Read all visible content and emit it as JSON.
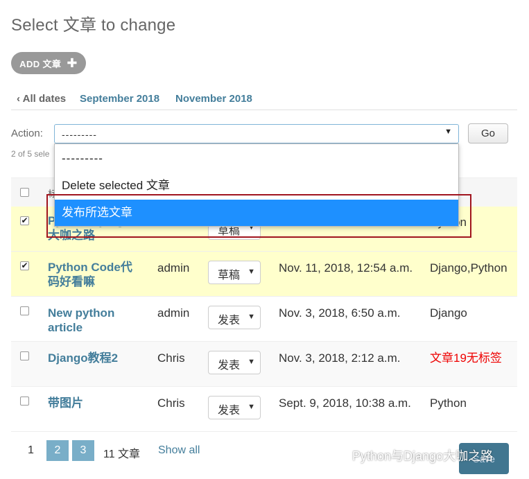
{
  "header": {
    "title": "Select 文章 to change"
  },
  "add_button": {
    "label": "ADD 文章",
    "icon": "plus-icon"
  },
  "date_filter": {
    "all": "‹ All dates",
    "months": [
      "September 2018",
      "November 2018"
    ]
  },
  "actions": {
    "label": "Action:",
    "selected": "---------",
    "go": "Go",
    "selection_count": "2 of 5 sele",
    "options": [
      "---------",
      "Delete selected 文章",
      "发布所选文章"
    ],
    "highlighted_index": 2
  },
  "table": {
    "header_partial": "标",
    "rows": [
      {
        "title": "Python Django 大咖之路",
        "author": "",
        "status": "草稿",
        "date": "",
        "tags": "Python",
        "checked": true,
        "selected": true
      },
      {
        "title": "Python Code代码好看嘛",
        "author": "admin",
        "status": "草稿",
        "date": "Nov. 11, 2018, 12:54 a.m.",
        "tags": "Django,Python",
        "checked": true,
        "selected": true
      },
      {
        "title": "New python article",
        "author": "admin",
        "status": "发表",
        "date": "Nov. 3, 2018, 6:50 a.m.",
        "tags": "Django",
        "checked": false,
        "selected": false
      },
      {
        "title": "Django教程2",
        "author": "Chris",
        "status": "发表",
        "date": "Nov. 3, 2018, 2:12 a.m.",
        "tags": "文章19无标签",
        "checked": false,
        "selected": false,
        "tag_color": "#e00000"
      },
      {
        "title": "带图片",
        "author": "Chris",
        "status": "发表",
        "date": "Sept. 9, 2018, 10:38 a.m.",
        "tags": "Python",
        "checked": false,
        "selected": false
      }
    ]
  },
  "pagination": {
    "pages": [
      "1",
      "2",
      "3"
    ],
    "count": "11 文章",
    "show_all": "Show all"
  },
  "footer": {
    "save": "Save"
  },
  "watermark": {
    "text": "Python与Django大咖之路",
    "icon": "wechat-icon"
  },
  "colors": {
    "link": "#447e9b",
    "highlight": "#1e90ff",
    "selected_row": "#ffffcc",
    "annotation_box": "#a0141e"
  }
}
